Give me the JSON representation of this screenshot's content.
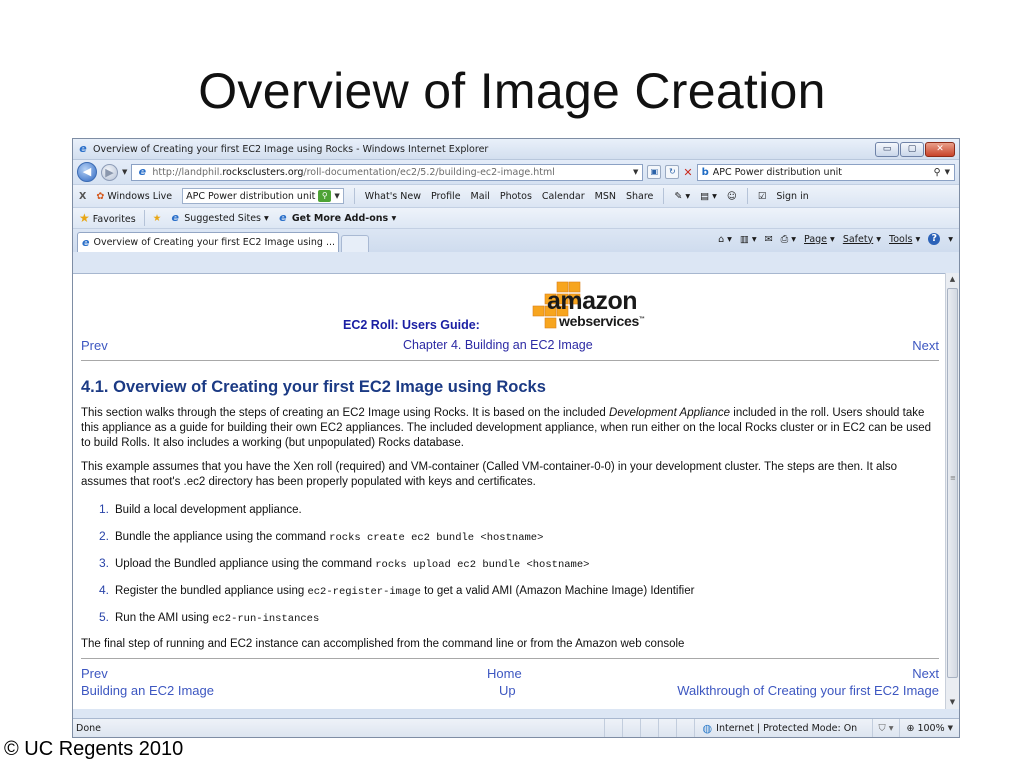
{
  "slide": {
    "title": "Overview of Image Creation",
    "copyright": "© UC Regents 2010"
  },
  "browser": {
    "window_title": "Overview of Creating your first EC2 Image using Rocks - Windows Internet Explorer",
    "window_buttons": {
      "minimize": "▭",
      "restore": "▢",
      "close": "✕"
    },
    "address": {
      "url_prefix": "http://landphil.",
      "url_domain": "rocksclusters.org",
      "url_path": "/roll-documentation/ec2/5.2/building-ec2-image.html"
    },
    "search": {
      "value": "APC Power distribution unit",
      "icon": "search-icon"
    },
    "live_bar": {
      "close": "X",
      "brand": "Windows Live",
      "search_value": "APC Power distribution unit",
      "links": [
        "What's New",
        "Profile",
        "Mail",
        "Photos",
        "Calendar",
        "MSN",
        "Share"
      ],
      "sign_in": "Sign in"
    },
    "favorites_bar": {
      "favorites": "Favorites",
      "suggested": "Suggested Sites ▾",
      "addons": "Get More Add-ons ▾"
    },
    "tab": {
      "label": "Overview of Creating your first EC2 Image using ..."
    },
    "command_bar": {
      "page": "Page",
      "safety": "Safety",
      "tools": "Tools",
      "help": "?"
    },
    "status": {
      "left": "Done",
      "zone": "Internet | Protected Mode: On",
      "zoom": "100%"
    }
  },
  "page": {
    "logo": {
      "line1": "amazon",
      "line2": "webservices",
      "tm": "™"
    },
    "guide_title": "EC2 Roll: Users Guide:",
    "chapter": "Chapter 4. Building an EC2 Image",
    "prev": "Prev",
    "next": "Next",
    "section_title": "4.1. Overview of Creating your first EC2 Image using Rocks",
    "para1_a": "This section walks through the steps of creating an EC2 Image using Rocks. It is based on the included ",
    "para1_em": "Development Appliance",
    "para1_b": " included in the roll. Users should take this appliance as a guide for building their own EC2 appliances. The included development appliance, when run either on the local Rocks cluster or in EC2 can be used to build Rolls. It also includes a working (but unpopulated) Rocks database.",
    "para2": "This example assumes that you have the Xen roll (required) and VM-container (Called VM-container-0-0) in your development cluster. The steps are then. It also assumes that root's .ec2 directory has been properly populated with keys and certificates.",
    "steps": [
      {
        "num": "1.",
        "text": "Build a local development appliance.",
        "code": "",
        "after": ""
      },
      {
        "num": "2.",
        "text": "Bundle the appliance using the command ",
        "code": "rocks create ec2 bundle <hostname>",
        "after": ""
      },
      {
        "num": "3.",
        "text": "Upload the Bundled appliance using the command ",
        "code": "rocks upload ec2 bundle <hostname>",
        "after": ""
      },
      {
        "num": "4.",
        "text": "Register the bundled appliance using ",
        "code": "ec2-register-image",
        "after": " to get a valid AMI (Amazon Machine Image) Identifier"
      },
      {
        "num": "5.",
        "text": "Run the AMI using ",
        "code": "ec2-run-instances",
        "after": ""
      }
    ],
    "final_para": "The final step of running and EC2 instance can accomplished from the command line or from the Amazon web console",
    "footer": {
      "prev": "Prev",
      "home": "Home",
      "next": "Next",
      "prev_title": "Building an EC2 Image",
      "up": "Up",
      "next_title": "Walkthrough of Creating your first EC2 Image"
    }
  }
}
